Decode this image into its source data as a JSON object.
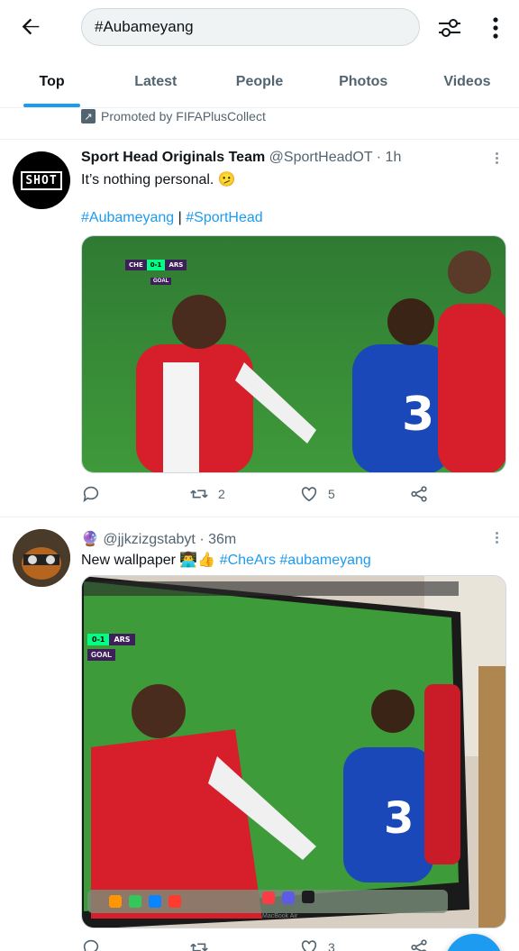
{
  "search": {
    "query": "#Aubameyang"
  },
  "tabs": [
    "Top",
    "Latest",
    "People",
    "Photos",
    "Videos"
  ],
  "promoted": {
    "text": "Promoted by FIFAPlusCollect"
  },
  "tweets": [
    {
      "name": "Sport Head Originals Team",
      "handle": "@SportHeadOT",
      "time": "· 1h",
      "text": "It’s nothing personal. 🫤",
      "tag1": "#Aubameyang",
      "separator": "|",
      "tag2": "#SportHead",
      "avatar_text": "SHOT",
      "retweets": "2",
      "likes": "5",
      "scoreboard": {
        "home": "CHE",
        "score": "0-1",
        "away": "ARS",
        "status": "GOAL"
      }
    },
    {
      "badge": "🔮",
      "handle": "@jjkzizgstabyt",
      "time": "· 36m",
      "text": "New wallpaper 👨‍💻👍",
      "tag1": "#CheArs",
      "tag2": "#aubameyang",
      "likes": "3",
      "scoreboard": {
        "score": "0-1",
        "away": "ARS",
        "status": "GOAL"
      },
      "laptop_label": "MacBook Air"
    }
  ],
  "icons": {
    "back": "arrow-left-icon",
    "filter": "sliders-icon",
    "more": "vertical-dots-icon",
    "reply": "comment-icon",
    "retweet": "retweet-icon",
    "like": "heart-icon",
    "share": "share-icon"
  },
  "colors": {
    "accent": "#1d9bf0",
    "text": "#0f1419",
    "secondary": "#536471"
  }
}
